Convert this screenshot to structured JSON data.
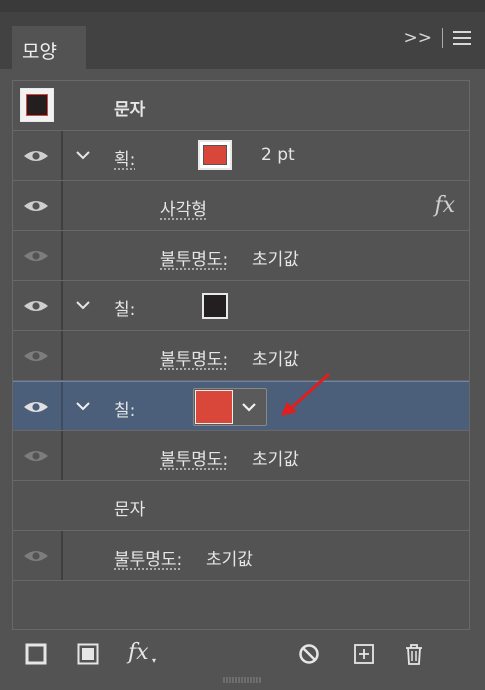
{
  "panel": {
    "tab_label": "모양",
    "expand_label": ">>"
  },
  "rows": {
    "header": {
      "label": "문자"
    },
    "stroke": {
      "label": "획:",
      "weight": "2 pt",
      "color": "#d9473a"
    },
    "effect": {
      "label": "사각형",
      "fx": "fx"
    },
    "stroke_opacity": {
      "label": "불투명도:",
      "value": "초기값"
    },
    "fill1": {
      "label": "칠:",
      "color": "#231f20"
    },
    "fill1_opacity": {
      "label": "불투명도:",
      "value": "초기값"
    },
    "fill2": {
      "label": "칠:",
      "color": "#d9473a"
    },
    "fill2_opacity": {
      "label": "불투명도:",
      "value": "초기값"
    },
    "chars": {
      "label": "문자"
    },
    "final_opacity": {
      "label": "불투명도:",
      "value": "초기값"
    }
  },
  "footer": {
    "fx": "fx"
  },
  "colors": {
    "accent_red": "#d9473a",
    "selection": "#4b5f7a",
    "arrow": "#e01e1e"
  },
  "icons": [
    "eye-icon",
    "chevron-down-icon",
    "fx-icon",
    "new-stroke-icon",
    "new-fill-icon",
    "clear-appearance-icon",
    "duplicate-item-icon",
    "delete-item-icon"
  ]
}
